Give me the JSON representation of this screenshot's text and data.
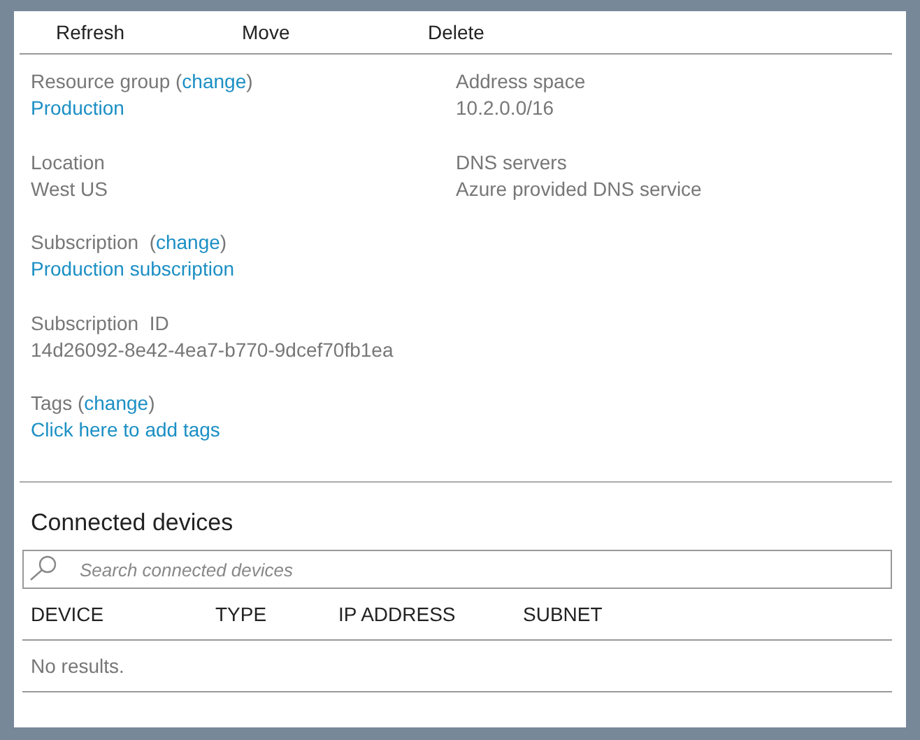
{
  "toolbar": [
    "Refresh",
    "Move",
    "Delete"
  ],
  "left_fields": [
    {
      "label_before": "Resource group (",
      "link": "change",
      "label_after": ")",
      "value": "Production",
      "kind": "link"
    },
    {
      "label_before": "Location",
      "value": "West US",
      "kind": "text"
    },
    {
      "label_before": "Subscription  (",
      "link": "change",
      "label_after": ")",
      "value": "Production subscription",
      "kind": "link"
    },
    {
      "label_before": "Subscription  ID",
      "value": "14d26092-8e42-4ea7-b770-9dcef70fb1ea",
      "kind": "text"
    },
    {
      "label_before": "Tags (",
      "link": "change",
      "label_after": ")",
      "value": "Click here to add tags",
      "kind": "link"
    }
  ],
  "right_fields": [
    {
      "label_before": "Address space",
      "value": "10.2.0.0/16",
      "kind": "text"
    },
    {
      "label_before": "DNS servers",
      "value": "Azure provided DNS service",
      "kind": "text"
    }
  ],
  "devices": {
    "title": "Connected devices",
    "search": {
      "placeholder": "Search connected devices"
    },
    "columns": [
      "DEVICE",
      "TYPE",
      "IP ADDRESS",
      "SUBNET"
    ],
    "empty_message": "No results."
  }
}
